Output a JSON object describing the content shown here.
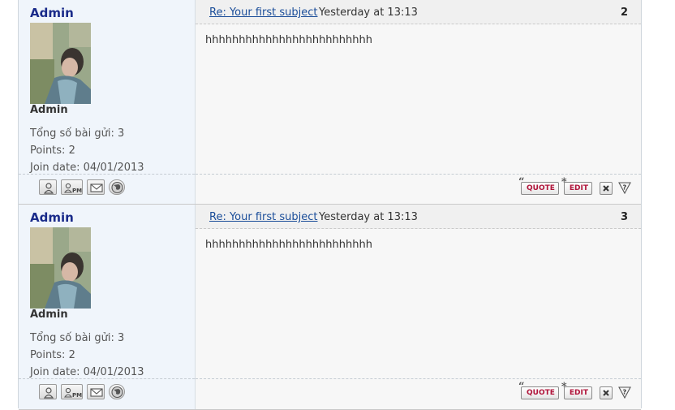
{
  "posts": [
    {
      "username": "Admin",
      "rank": "Admin",
      "fields": {
        "posts": "Tổng số bài gửi: 3",
        "points": "Points: 2",
        "join_date": "Join date: 04/01/2013"
      },
      "subject": "Re: Your first subject",
      "date": "Yesterday at 13:13",
      "number": "2",
      "content": "hhhhhhhhhhhhhhhhhhhhhhhhh"
    },
    {
      "username": "Admin",
      "rank": "Admin",
      "fields": {
        "posts": "Tổng số bài gửi: 3",
        "points": "Points: 2",
        "join_date": "Join date: 04/01/2013"
      },
      "subject": "Re: Your first subject",
      "date": "Yesterday at 13:13",
      "number": "3",
      "content": "hhhhhhhhhhhhhhhhhhhhhhhhh"
    }
  ],
  "actions": {
    "quote_label": "QUOTE",
    "edit_label": "EDIT",
    "quote_mark": "“",
    "edit_mark": "*"
  },
  "icons": {
    "profile": "user-icon",
    "pm": "private-message-icon",
    "email": "envelope-icon",
    "website": "globe-icon",
    "delete": "delete-icon",
    "report": "report-icon"
  },
  "colors": {
    "username": "#1a2b8a",
    "link": "#1a4d99",
    "action_text": "#b0143a"
  }
}
